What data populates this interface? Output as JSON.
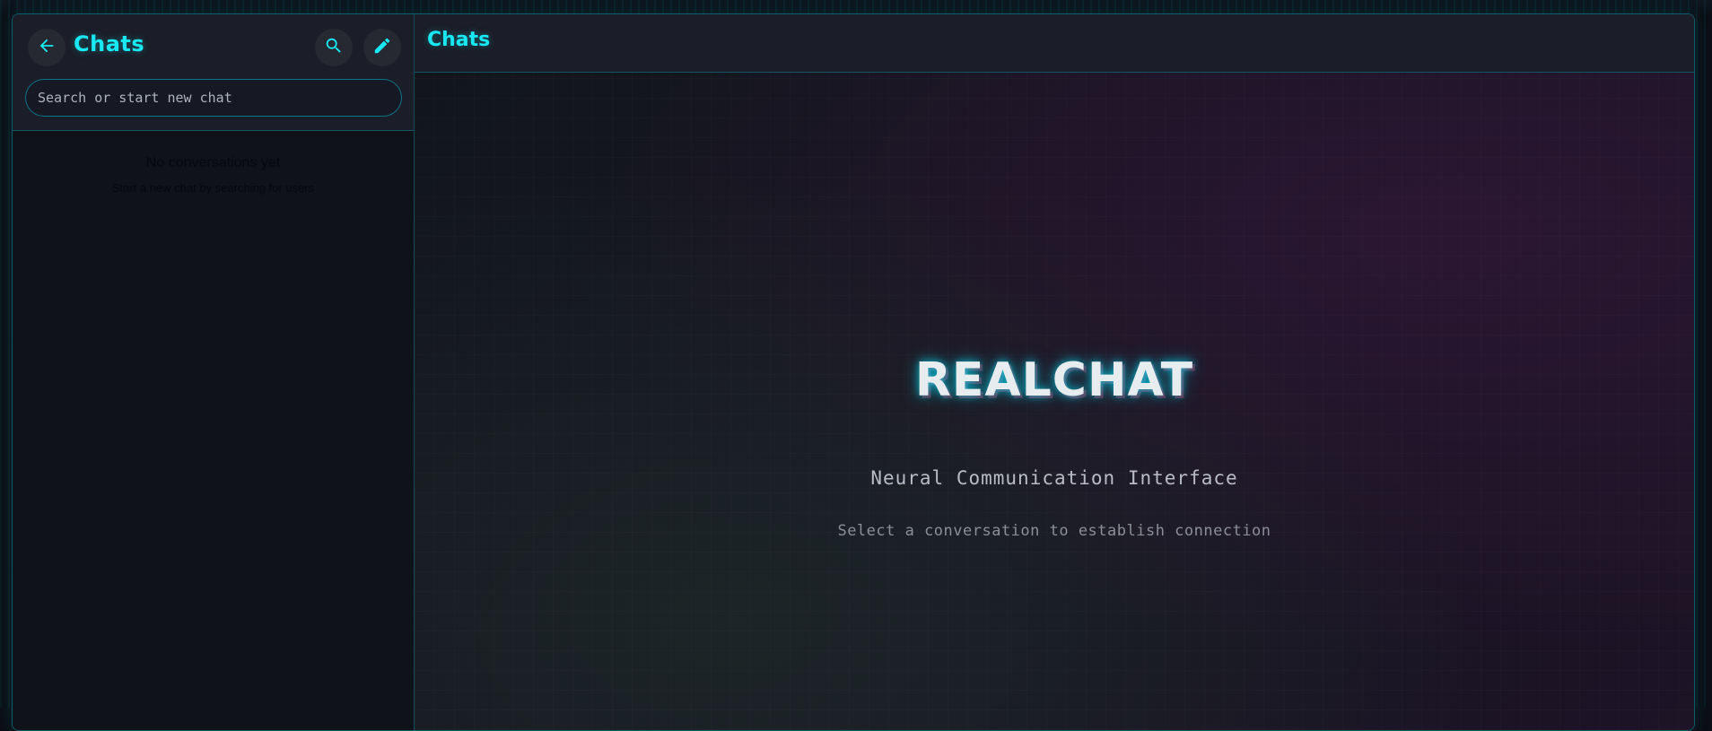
{
  "sidebar": {
    "title": "Chats",
    "back_icon": "arrow-left-icon",
    "search_icon": "search-icon",
    "compose_icon": "pencil-icon",
    "search_placeholder": "Search or start new chat",
    "empty_title": "No conversations yet",
    "empty_subtitle": "Start a new chat by searching for users"
  },
  "main": {
    "header_title": "Chats",
    "logo": "REALCHAT",
    "tagline": "Neural Communication Interface",
    "hint": "Select a conversation to establish connection"
  },
  "colors": {
    "accent": "#19e8f2",
    "background": "#12141c",
    "panel": "#1b1d28"
  }
}
